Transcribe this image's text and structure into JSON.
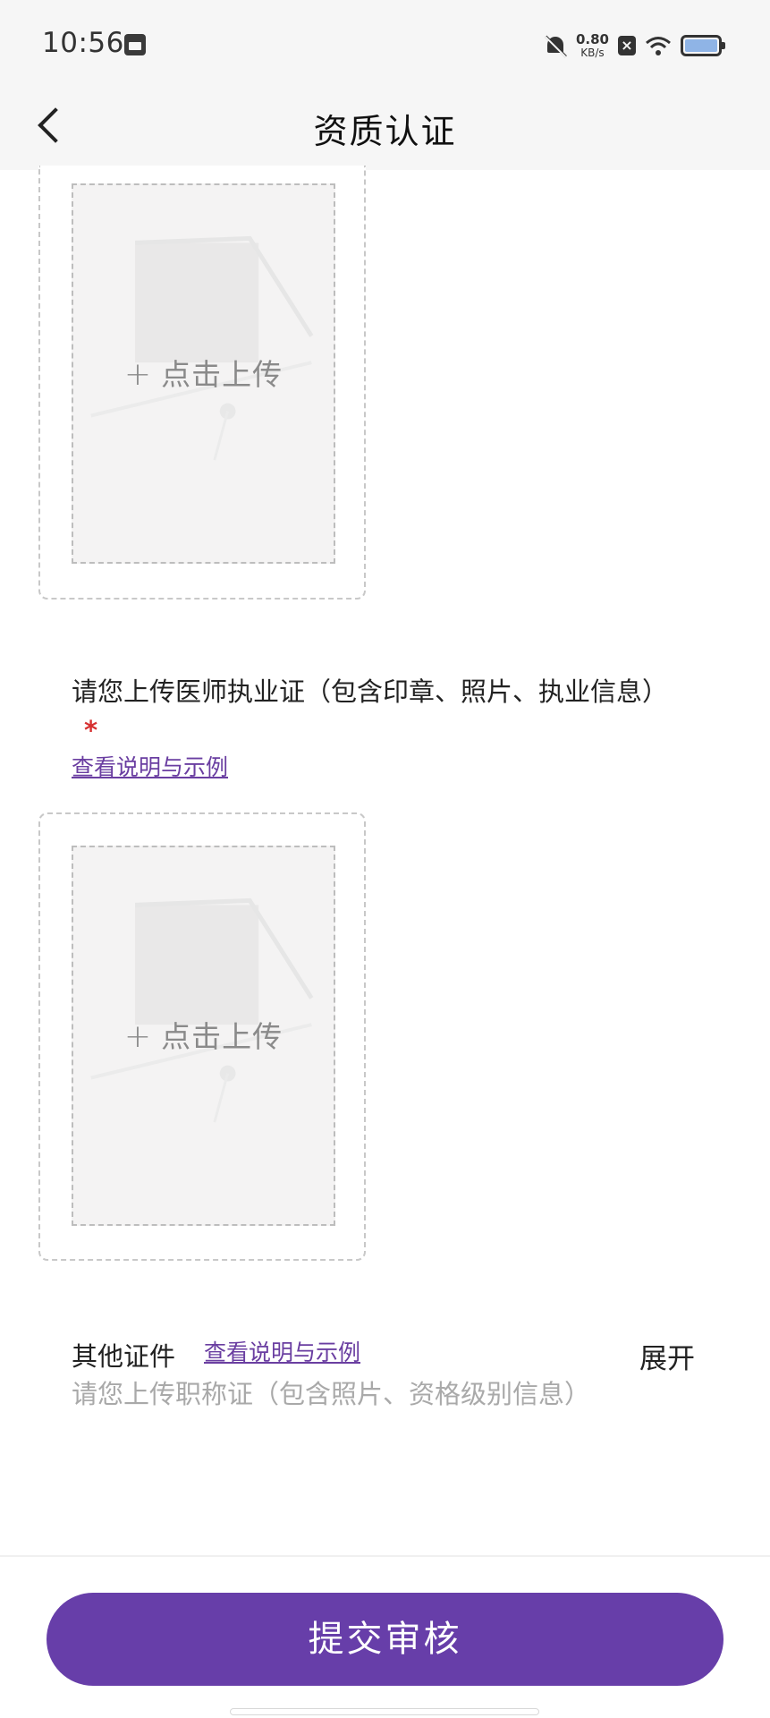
{
  "status_bar": {
    "time": "10:56",
    "net_speed_value": "0.80",
    "net_speed_unit": "KB/s",
    "icons": [
      "app-calendar-icon",
      "bell-muted-icon",
      "x-box-icon",
      "wifi-icon",
      "battery-icon"
    ]
  },
  "nav": {
    "title": "资质认证",
    "back_icon": "chevron-left-icon"
  },
  "upload_boxes": [
    {
      "label": "点击上传",
      "icon": "plus-icon"
    },
    {
      "label": "点击上传",
      "icon": "plus-icon"
    }
  ],
  "license_section": {
    "title": "请您上传医师执业证（包含印章、照片、执业信息）",
    "required_mark": "*",
    "example_link": "查看说明与示例"
  },
  "other_section": {
    "title": "其他证件",
    "example_link": "查看说明与示例",
    "expand_label": "展开",
    "hint": "请您上传职称证（包含照片、资格级别信息）"
  },
  "submit": {
    "label": "提交审核"
  },
  "colors": {
    "accent": "#673ea9",
    "link": "#6a3ea1",
    "required": "#d63030"
  }
}
